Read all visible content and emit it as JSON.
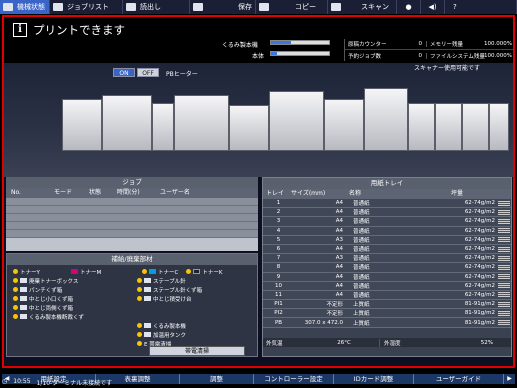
{
  "menu": {
    "tabs": [
      {
        "label": "機械状態",
        "icon": "machine-status-icon"
      },
      {
        "label": "ジョブリスト",
        "icon": "job-list-icon"
      },
      {
        "label": "読出し",
        "icon": "recall-icon"
      },
      {
        "label": "保存",
        "icon": "save-icon"
      },
      {
        "label": "コピー",
        "icon": "copy-icon"
      },
      {
        "label": "スキャン",
        "icon": "scan-icon"
      }
    ],
    "icons": [
      "globe-icon",
      "speaker-icon",
      "help-icon"
    ]
  },
  "status": {
    "message": "プリントできます",
    "scanner": "スキャナー使用可能です"
  },
  "counters": {
    "machine1": "くるみ製本機",
    "machine2": "本体",
    "machine1_level": 0.35,
    "machine2_level": 0.1,
    "rows": [
      {
        "label": "原稿カウンター",
        "value": "0",
        "label2": "メモリー残量",
        "value2": "100.000%"
      },
      {
        "label": "予約ジョブ数",
        "value": "0",
        "label2": "ファイルシステム残量",
        "value2": "100.000%"
      }
    ]
  },
  "pb_heater": {
    "on": "ON",
    "off": "OFF",
    "label": "PBヒーター",
    "state": "ON"
  },
  "job": {
    "title": "ジョブ",
    "columns": [
      "No.",
      "モード",
      "状態",
      "時間(分)",
      "ユーザー名"
    ]
  },
  "supplies": {
    "title": "補給/廃棄部材",
    "left": [
      {
        "icon": "toner-y-icon",
        "label": "トナーY",
        "color": "#f2d200"
      },
      {
        "icon": "waste-toner-icon",
        "label": "廃棄トナーボックス"
      },
      {
        "icon": "punch-waste-icon",
        "label": "パンチくず箱"
      },
      {
        "icon": "staple-waste-icon",
        "label": "中とじ小口くず箱"
      },
      {
        "icon": "staple-waste-icon",
        "label": "中とじ両側くず箱"
      },
      {
        "icon": "binder-waste-icon",
        "label": "くるみ製本機断裁くず"
      }
    ],
    "middle": [
      {
        "icon": "toner-m-icon",
        "label": "トナーM",
        "color": "#d6007a"
      },
      {
        "icon": "staple-icon",
        "label": "ステープル針"
      },
      {
        "icon": "staple-waste-icon",
        "label": "ステープル針くず箱"
      },
      {
        "icon": "tray-icon",
        "label": "中とじ積受け台"
      }
    ],
    "right_top": [
      {
        "icon": "toner-c-icon",
        "label": "トナーC",
        "color": "#00a0e0"
      },
      {
        "icon": "toner-k-icon",
        "label": "トナーK",
        "color": "#222222"
      }
    ],
    "bottom": [
      {
        "icon": "binder-icon",
        "label": "くるみ製本機"
      },
      {
        "icon": "glue-tank-icon",
        "label": "加温用タンク"
      },
      {
        "icon": "static-icon",
        "label": "E  帯電清掃"
      }
    ],
    "button": "帯電清掃"
  },
  "paper_tray": {
    "title": "用紙トレイ",
    "columns": [
      "トレイ",
      "サイズ(mm)",
      "名称",
      "坪量"
    ],
    "rows": [
      {
        "tray": "1",
        "size": "A4",
        "name": "普通紙",
        "weight": "62-74g/m2"
      },
      {
        "tray": "2",
        "size": "A4",
        "name": "普通紙",
        "weight": "62-74g/m2"
      },
      {
        "tray": "3",
        "size": "A4",
        "name": "普通紙",
        "weight": "62-74g/m2"
      },
      {
        "tray": "4",
        "size": "A4",
        "name": "普通紙",
        "weight": "62-74g/m2"
      },
      {
        "tray": "5",
        "size": "A3",
        "name": "普通紙",
        "weight": "62-74g/m2"
      },
      {
        "tray": "6",
        "size": "A4",
        "name": "普通紙",
        "weight": "62-74g/m2"
      },
      {
        "tray": "7",
        "size": "A3",
        "name": "普通紙",
        "weight": "62-74g/m2"
      },
      {
        "tray": "8",
        "size": "A4",
        "name": "普通紙",
        "weight": "62-74g/m2"
      },
      {
        "tray": "9",
        "size": "A4",
        "name": "普通紙",
        "weight": "62-74g/m2"
      },
      {
        "tray": "10",
        "size": "A4",
        "name": "普通紙",
        "weight": "62-74g/m2"
      },
      {
        "tray": "11",
        "size": "A4",
        "name": "普通紙",
        "weight": "62-74g/m2"
      },
      {
        "tray": "PI1",
        "size": "不定形",
        "name": "上質紙",
        "weight": "81-91g/m2"
      },
      {
        "tray": "PI2",
        "size": "不定形",
        "name": "上質紙",
        "weight": "81-91g/m2"
      },
      {
        "tray": "PB",
        "size": "307.0 x 472.0",
        "name": "上質紙",
        "weight": "81-91g/m2"
      }
    ],
    "outside_temp_label": "外気温",
    "outside_temp": "26°C",
    "humidity_label": "外湿度",
    "humidity": "52%"
  },
  "bottom_nav": [
    "用紙設定",
    "表裏調整",
    "調整",
    "コントローラー設定",
    "IDカード調整",
    "ユーザーガイド"
  ],
  "footer": {
    "time": "10:55",
    "message": "1/10-ターミナル未接続です"
  }
}
